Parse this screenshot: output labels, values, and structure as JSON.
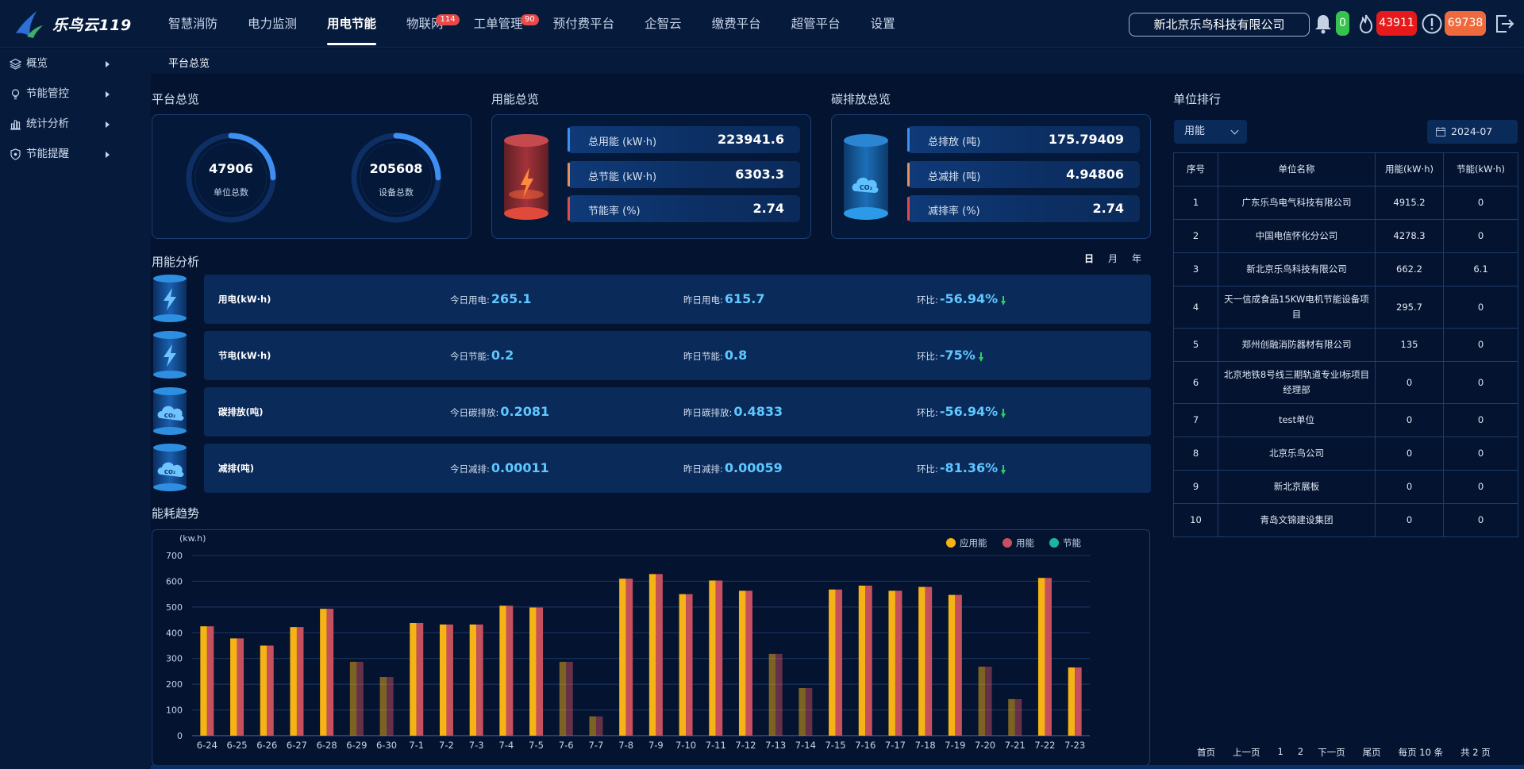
{
  "header": {
    "logo_text": "乐鸟云119",
    "nav": [
      {
        "label": "智慧消防",
        "badge": null
      },
      {
        "label": "电力监测",
        "badge": null
      },
      {
        "label": "用电节能",
        "badge": null,
        "active": true
      },
      {
        "label": "物联网",
        "badge": "114"
      },
      {
        "label": "工单管理",
        "badge": "90"
      },
      {
        "label": "预付费平台",
        "badge": null
      },
      {
        "label": "企智云",
        "badge": null
      },
      {
        "label": "缴费平台",
        "badge": null
      },
      {
        "label": "超管平台",
        "badge": null
      },
      {
        "label": "设置",
        "badge": null
      }
    ],
    "company": "新北京乐鸟科技有限公司",
    "bell_count": "0",
    "fire_count": "43911",
    "alert_count": "69738"
  },
  "sidebar": {
    "items": [
      {
        "label": "概览",
        "icon": "layers-icon"
      },
      {
        "label": "节能管控",
        "icon": "bulb-icon"
      },
      {
        "label": "统计分析",
        "icon": "bar-chart-icon"
      },
      {
        "label": "节能提醒",
        "icon": "shield-icon"
      }
    ]
  },
  "breadcrumb": "平台总览",
  "overview": {
    "title": "平台总览",
    "units": {
      "value": "47906",
      "label": "单位总数"
    },
    "devices": {
      "value": "205608",
      "label": "设备总数"
    }
  },
  "energy": {
    "title": "用能总览",
    "rows": [
      {
        "label": "总用能 (kW·h)",
        "value": "223941.6"
      },
      {
        "label": "总节能 (kW·h)",
        "value": "6303.3"
      },
      {
        "label": "节能率 (%)",
        "value": "2.74"
      }
    ]
  },
  "carbon": {
    "title": "碳排放总览",
    "rows": [
      {
        "label": "总排放 (吨)",
        "value": "175.79409"
      },
      {
        "label": "总减排 (吨)",
        "value": "4.94806"
      },
      {
        "label": "减排率 (%)",
        "value": "2.74"
      }
    ]
  },
  "analysis": {
    "title": "用能分析",
    "toggles": [
      "日",
      "月",
      "年"
    ],
    "rows": [
      {
        "name": "用电(kW·h)",
        "today_label": "今日用电:",
        "today": "265.1",
        "yest_label": "昨日用电:",
        "yest": "615.7",
        "ratio_label": "环比:",
        "ratio": "-56.94%"
      },
      {
        "name": "节电(kW·h)",
        "today_label": "今日节能:",
        "today": "0.2",
        "yest_label": "昨日节能:",
        "yest": "0.8",
        "ratio_label": "环比:",
        "ratio": "-75%"
      },
      {
        "name": "碳排放(吨)",
        "today_label": "今日碳排放:",
        "today": "0.2081",
        "yest_label": "昨日碳排放:",
        "yest": "0.4833",
        "ratio_label": "环比:",
        "ratio": "-56.94%"
      },
      {
        "name": "减排(吨)",
        "today_label": "今日减排:",
        "today": "0.00011",
        "yest_label": "昨日减排:",
        "yest": "0.00059",
        "ratio_label": "环比:",
        "ratio": "-81.36%"
      }
    ]
  },
  "trend": {
    "title": "能耗趋势"
  },
  "chart_data": {
    "type": "bar",
    "ylabel": "(kw.h)",
    "ylim": [
      0,
      700
    ],
    "yticks": [
      0,
      100,
      200,
      300,
      400,
      500,
      600,
      700
    ],
    "grid": true,
    "legend_position": "top-right",
    "categories": [
      "6-24",
      "6-25",
      "6-26",
      "6-27",
      "6-28",
      "6-29",
      "6-30",
      "7-1",
      "7-2",
      "7-3",
      "7-4",
      "7-5",
      "7-6",
      "7-7",
      "7-8",
      "7-9",
      "7-10",
      "7-11",
      "7-12",
      "7-13",
      "7-14",
      "7-15",
      "7-16",
      "7-17",
      "7-18",
      "7-19",
      "7-20",
      "7-21",
      "7-22",
      "7-23"
    ],
    "dim": [
      false,
      false,
      false,
      false,
      false,
      true,
      true,
      false,
      false,
      false,
      false,
      false,
      true,
      true,
      false,
      false,
      false,
      false,
      false,
      true,
      true,
      false,
      false,
      false,
      false,
      false,
      true,
      true,
      false,
      false
    ],
    "series": [
      {
        "name": "应用能",
        "color": "#f5b315",
        "values": [
          425,
          378,
          350,
          422,
          493,
          287,
          228,
          438,
          432,
          432,
          505,
          498,
          287,
          75,
          610,
          628,
          550,
          603,
          563,
          318,
          185,
          568,
          583,
          563,
          578,
          547,
          268,
          142,
          613,
          265
        ]
      },
      {
        "name": "用能",
        "color": "#c7505f",
        "values": [
          425,
          378,
          350,
          422,
          493,
          287,
          228,
          438,
          432,
          432,
          505,
          498,
          287,
          75,
          610,
          628,
          550,
          603,
          563,
          318,
          185,
          568,
          583,
          563,
          578,
          547,
          268,
          142,
          613,
          265
        ]
      },
      {
        "name": "节能",
        "color": "#1cb5a0",
        "values": [
          0,
          0,
          0,
          0,
          0,
          0,
          0,
          0,
          0,
          0,
          0,
          0,
          0,
          0,
          0,
          0,
          0,
          0,
          0,
          0,
          0,
          0,
          0,
          0,
          0,
          0,
          0,
          0,
          0,
          0
        ]
      }
    ]
  },
  "ranking": {
    "title": "单位排行",
    "select": "用能",
    "date": "2024-07",
    "headers": [
      "序号",
      "单位名称",
      "用能(kW·h)",
      "节能(kW·h)"
    ],
    "rows": [
      [
        "1",
        "广东乐鸟电气科技有限公司",
        "4915.2",
        "0"
      ],
      [
        "2",
        "中国电信怀化分公司",
        "4278.3",
        "0"
      ],
      [
        "3",
        "新北京乐鸟科技有限公司",
        "662.2",
        "6.1"
      ],
      [
        "4",
        "天一信成食品15KW电机节能设备项目",
        "295.7",
        "0"
      ],
      [
        "5",
        "郑州创融消防器材有限公司",
        "135",
        "0"
      ],
      [
        "6",
        "北京地铁8号线三期轨道专业Ⅰ标项目经理部",
        "0",
        "0"
      ],
      [
        "7",
        "test单位",
        "0",
        "0"
      ],
      [
        "8",
        "北京乐鸟公司",
        "0",
        "0"
      ],
      [
        "9",
        "新北京展板",
        "0",
        "0"
      ],
      [
        "10",
        "青岛文锦建设集团",
        "0",
        "0"
      ]
    ],
    "pager": [
      "首页",
      "上一页",
      "1",
      "2",
      "下一页",
      "尾页",
      "每页 10 条",
      "共 2 页"
    ]
  },
  "colors": {
    "accent": "#3d8ff2",
    "up": "#2bd05b",
    "fire": "#e61a1a",
    "alert": "#ee6a3c"
  }
}
